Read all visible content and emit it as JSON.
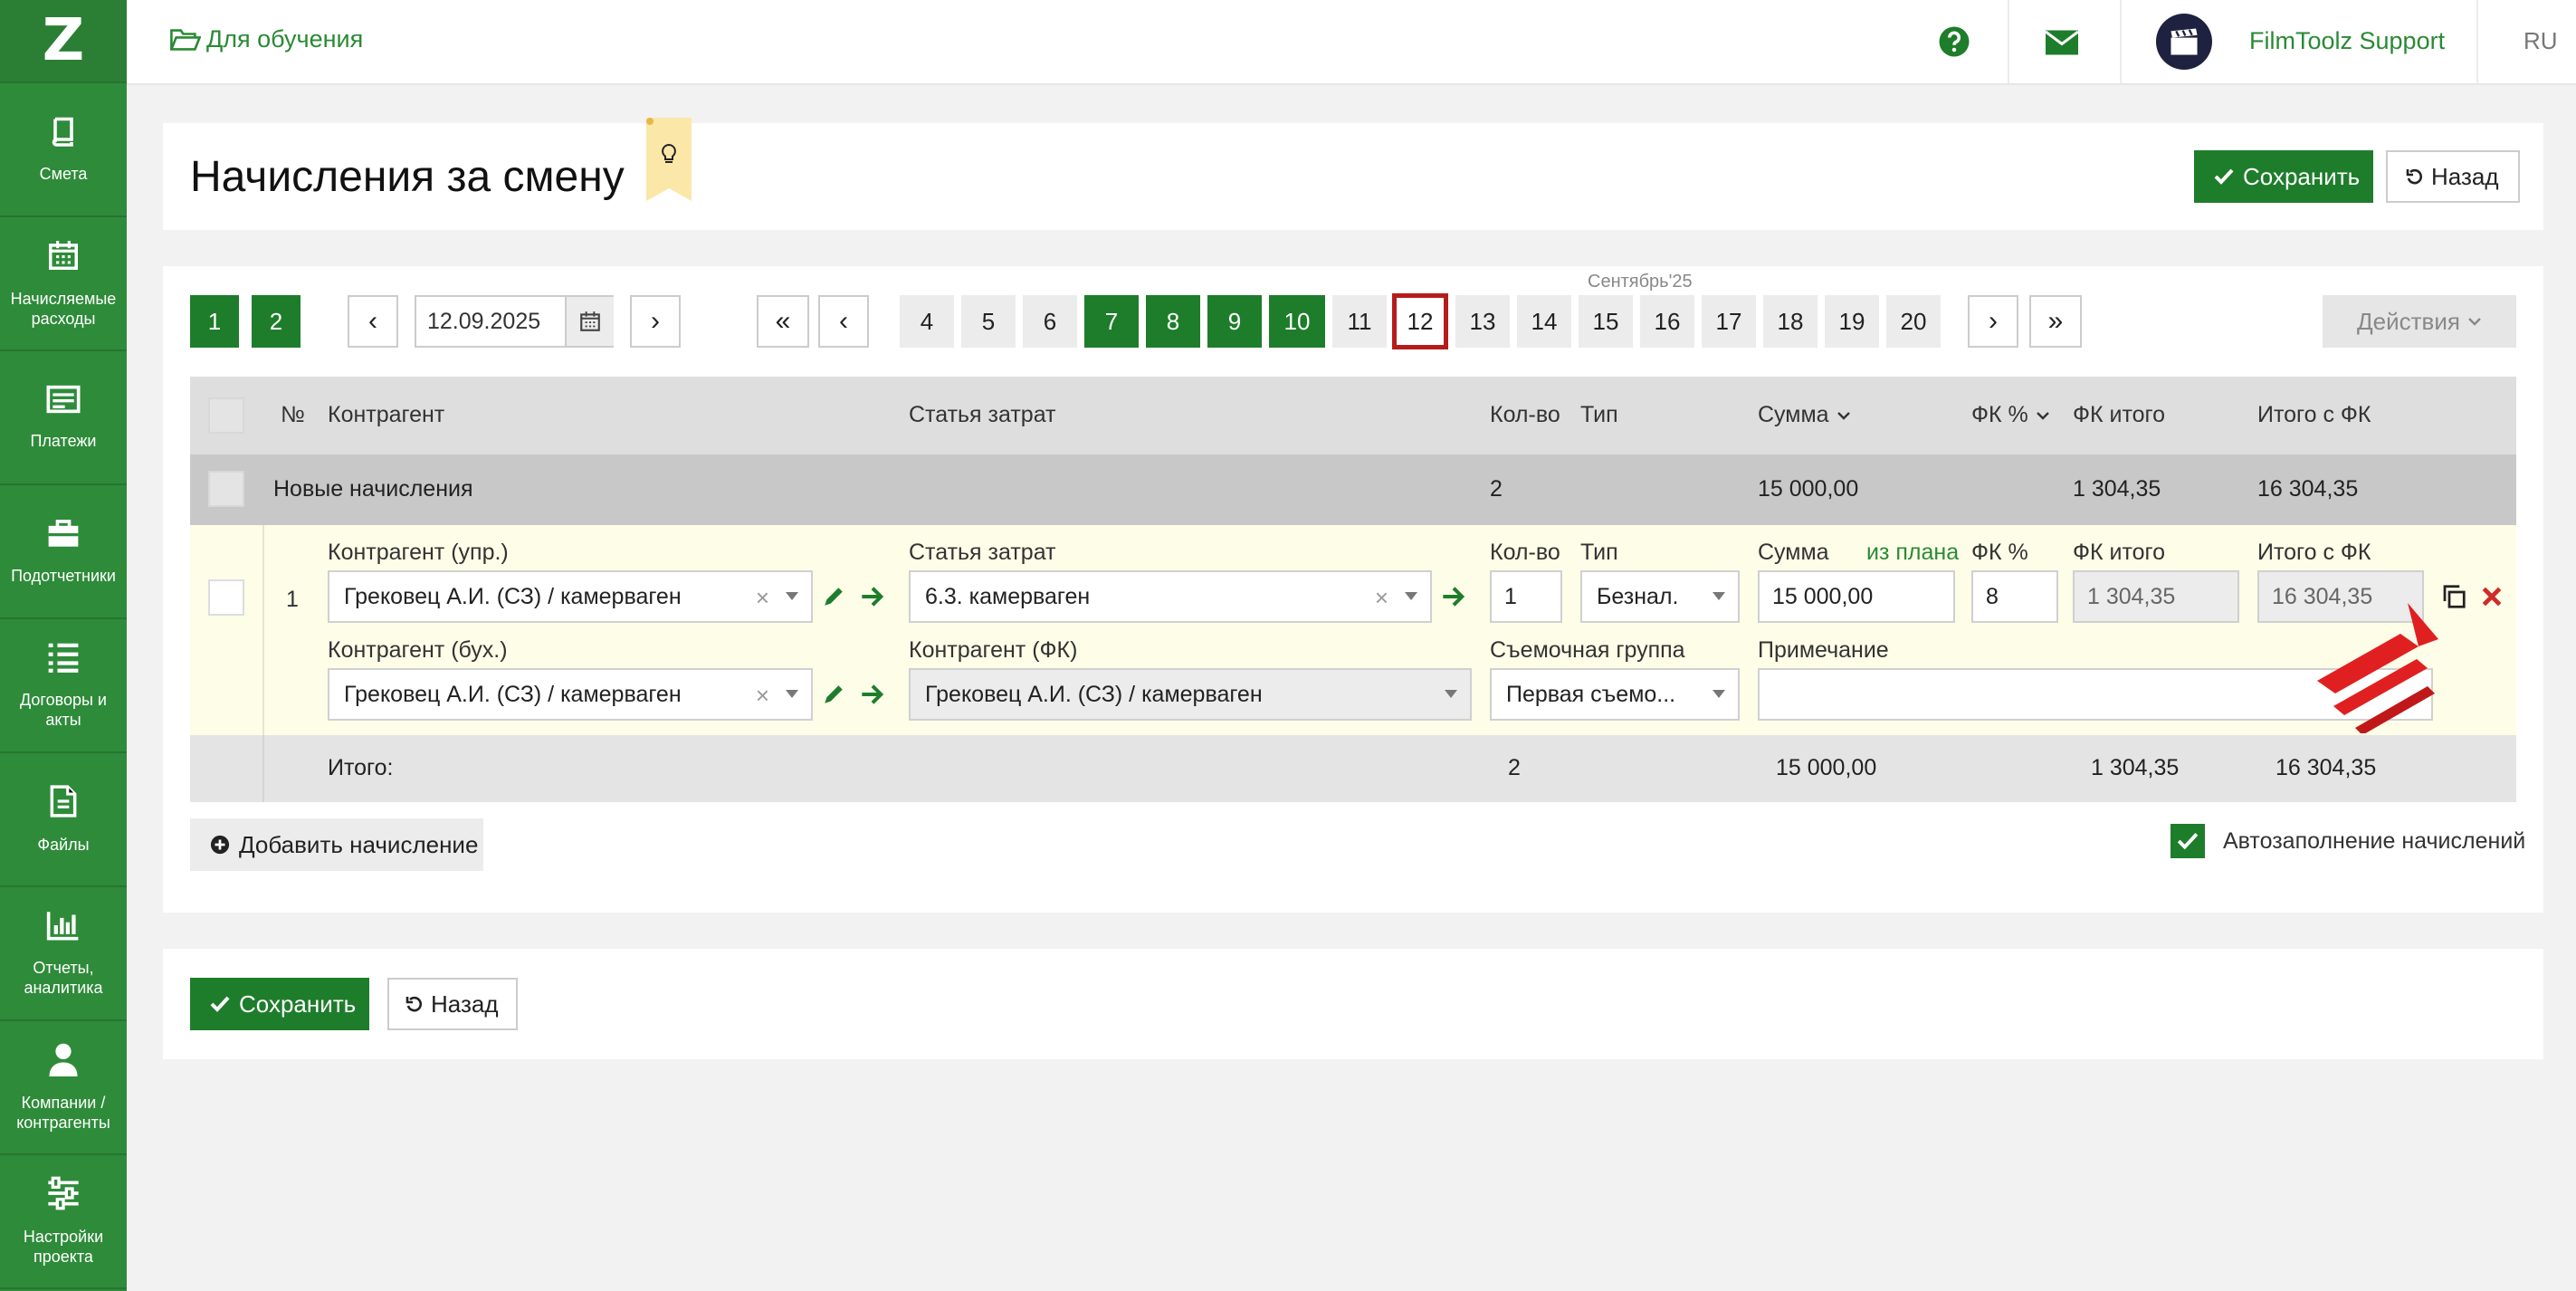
{
  "sidebar": {
    "logo": "Z",
    "items": [
      {
        "label": "Смета",
        "icon": "book-icon"
      },
      {
        "label": "Начисляемые расходы",
        "icon": "calendar-icon"
      },
      {
        "label": "Платежи",
        "icon": "payments-icon"
      },
      {
        "label": "Подотчетники",
        "icon": "briefcase-icon"
      },
      {
        "label": "Договоры и акты",
        "icon": "list-icon"
      },
      {
        "label": "Файлы",
        "icon": "file-icon"
      },
      {
        "label": "Отчеты, аналитика",
        "icon": "bar-chart-icon"
      },
      {
        "label": "Компании / контрагенты",
        "icon": "user-icon"
      },
      {
        "label": "Настройки проекта",
        "icon": "sliders-icon"
      }
    ]
  },
  "topbar": {
    "project": "Для обучения",
    "user": "FilmToolz Support",
    "lang": "RU"
  },
  "page": {
    "title": "Начисления за смену",
    "save": "Сохранить",
    "back": "Назад"
  },
  "pager": {
    "pages": [
      "1",
      "2"
    ],
    "date": "12.09.2025",
    "month": "Сентябрь'25",
    "days": [
      "4",
      "5",
      "6",
      "7",
      "8",
      "9",
      "10",
      "11",
      "12",
      "13",
      "14",
      "15",
      "16",
      "17",
      "18",
      "19",
      "20"
    ],
    "actions": "Действия"
  },
  "table": {
    "headers": {
      "num": "№",
      "contractor": "Контрагент",
      "cost_item": "Статья затрат",
      "qty": "Кол-во",
      "type": "Тип",
      "sum": "Сумма",
      "fk_pct": "ФК %",
      "fk_total": "ФК итого",
      "total_fk": "Итого с ФК"
    },
    "group": {
      "label": "Новые начисления",
      "qty": "2",
      "sum": "15 000,00",
      "fk_total": "1 304,35",
      "total_fk": "16 304,35"
    },
    "row": {
      "num": "1",
      "contractor_mgmt_label": "Контрагент (упр.)",
      "contractor_mgmt": "Грековец А.И. (СЗ) / камерваген",
      "contractor_acc_label": "Контрагент (бух.)",
      "contractor_acc": "Грековец А.И. (СЗ) / камерваген",
      "cost_item_label": "Статья затрат",
      "cost_item": "6.3. камерваген",
      "contractor_fk_label": "Контрагент (ФК)",
      "contractor_fk": "Грековец А.И. (СЗ) / камерваген",
      "qty_label": "Кол-во",
      "qty": "1",
      "type_label": "Тип",
      "type": "Безнал.",
      "group_label": "Съемочная группа",
      "group": "Первая съемо...",
      "sum_label": "Сумма",
      "from_plan": "из плана",
      "sum": "15 000,00",
      "note_label": "Примечание",
      "note": "",
      "fk_pct_label": "ФК %",
      "fk_pct": "8",
      "fk_total_label": "ФК итого",
      "fk_total": "1 304,35",
      "total_fk_label": "Итого с ФК",
      "total_fk": "16 304,35",
      "clear_symbol": "×"
    },
    "totals": {
      "label": "Итого:",
      "qty": "2",
      "sum": "15 000,00",
      "fk_total": "1 304,35",
      "total_fk": "16 304,35"
    }
  },
  "footer": {
    "add": "Добавить начисление",
    "autofill": "Автозаполнение начислений"
  },
  "colors": {
    "brand": "#2e8b3a",
    "primary": "#1e7d2b",
    "selected_border": "#b61b1b",
    "row_bg": "#fdfde8"
  }
}
